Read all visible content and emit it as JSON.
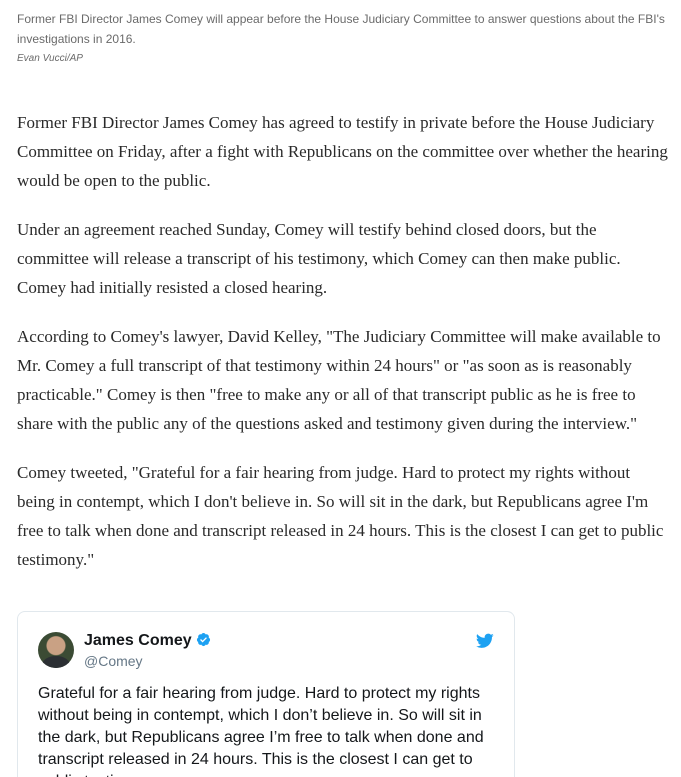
{
  "photo": {
    "caption": "Former FBI Director James Comey will appear before the House Judiciary Committee to answer questions about the FBI's investigations in 2016.",
    "credit": "Evan Vucci/AP"
  },
  "article": {
    "paragraphs": [
      "Former FBI Director James Comey has agreed to testify in private before the House Judiciary Committee on Friday, after a fight with Republicans on the committee over whether the hearing would be open to the public.",
      "Under an agreement reached Sunday, Comey will testify behind closed doors, but the committee will release a transcript of his testimony, which Comey can then make public. Comey had initially resisted a closed hearing.",
      "According to Comey's lawyer, David Kelley, \"The Judiciary Committee will make available to Mr. Comey a full transcript of that testimony within 24 hours\" or \"as soon as is reasonably practicable.\" Comey is then \"free to make any or all of that transcript public as he is free to share with the public any of the questions asked and testimony given during the interview.\"",
      "Comey tweeted, \"Grateful for a fair hearing from judge. Hard to protect my rights without being in contempt, which I don't believe in. So will sit in the dark, but Republicans agree I'm free to talk when done and transcript released in 24 hours. This is the closest I can get to public testimony.\""
    ]
  },
  "tweet": {
    "author_name": "James Comey",
    "handle": "@Comey",
    "text": "Grateful for a fair hearing from judge. Hard to protect my rights without being in contempt, which I don’t believe in. So will sit in the dark, but Republicans agree I’m free to talk when done and transcript released in 24 hours. This is the closest I can get to public testimony.",
    "verified_icon": "verified-badge-icon",
    "brand_icon": "twitter-bird-icon",
    "colors": {
      "brand": "#1da1f2",
      "border": "#e1e8ed",
      "handle": "#657786"
    }
  }
}
